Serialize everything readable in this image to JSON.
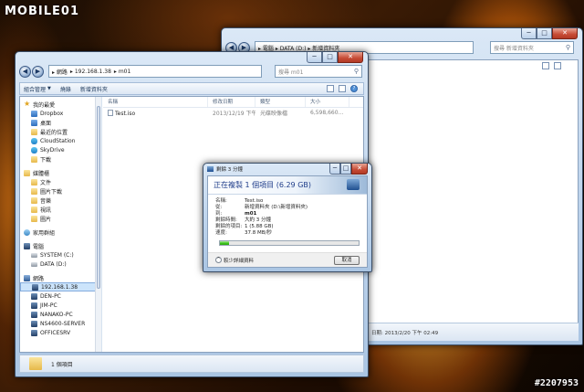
{
  "branding": {
    "logo_text": "MOBILE01",
    "watermark": "#2207953"
  },
  "back_window": {
    "address_text": "▸ 電腦 ▸ DATA (D:) ▸ 新增資料夾",
    "search_placeholder": "搜尋 新增資料夾",
    "status_text": "日期: 2013/2/20 下午 02:49"
  },
  "explorer": {
    "address_parts": [
      "▸ 網路",
      "▸ 192.168.1.38",
      "▸ m01"
    ],
    "search_placeholder": "搜尋 m01",
    "commands": [
      "組合管理",
      "燒錄",
      "新增資料夾"
    ],
    "nav_pane": {
      "favorites": {
        "label": "我的最愛",
        "items": [
          "Dropbox",
          "桌面",
          "最近的位置",
          "CloudStation",
          "SkyDrive",
          "下載"
        ]
      },
      "libraries": {
        "label": "媒體櫃",
        "items": [
          "文件",
          "圖片下載",
          "音樂",
          "視訊",
          "圖片"
        ]
      },
      "homegroup": {
        "label": "家用群組"
      },
      "computer": {
        "label": "電腦",
        "items": [
          "SYSTEM (C:)",
          "DATA (D:)"
        ]
      },
      "network": {
        "label": "網路",
        "items": [
          "192.168.1.38",
          "DEN-PC",
          "JIM-PC",
          "NANAKO-PC",
          "NS4600-SERVER",
          "OFFICESRV"
        ]
      }
    },
    "columns": [
      "名稱",
      "修改日期",
      "類型",
      "大小"
    ],
    "files": [
      {
        "name": "Test.iso",
        "modified": "2013/12/19 下午 ...",
        "type": "光碟映像檔",
        "size": "6,598,660..."
      }
    ],
    "status_text": "1 個項目"
  },
  "copy_dialog": {
    "title": "剩餘 3 分鐘",
    "heading": "正在複製 1 個項目 (6.29 GB)",
    "rows": [
      {
        "k": "名稱:",
        "v": "Test.iso"
      },
      {
        "k": "從:",
        "v": "新增資料夾 (D:\\新增資料夾)"
      },
      {
        "k": "到:",
        "v": "m01"
      },
      {
        "k": "剩餘時間:",
        "v": "大約 3 分鐘"
      },
      {
        "k": "剩餘的項目:",
        "v": "1 (5.88 GB)"
      },
      {
        "k": "速度:",
        "v": "37.8 MB/秒"
      }
    ],
    "progress_percent": 6.5,
    "more_info_label": "較少詳細資料",
    "cancel_label": "取消"
  },
  "caption_buttons": {
    "min": "─",
    "max": "□",
    "close": "✕"
  }
}
